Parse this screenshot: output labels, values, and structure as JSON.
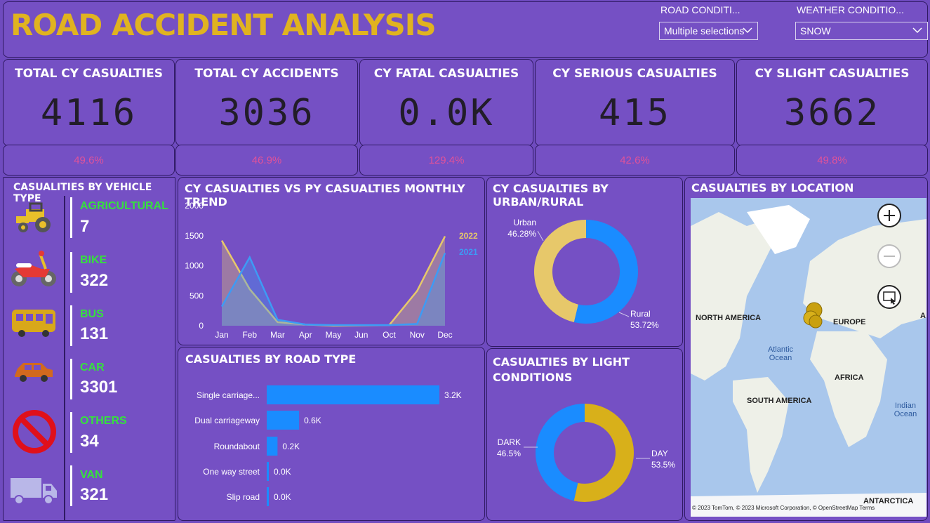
{
  "header": {
    "title": "ROAD ACCIDENT ANALYSIS",
    "slicers": [
      {
        "label": "ROAD CONDITI...",
        "value": "Multiple selections"
      },
      {
        "label": "WEATHER CONDITIO...",
        "value": "SNOW"
      }
    ]
  },
  "kpis": [
    {
      "title": "TOTAL CY CASUALTIES",
      "value": "4116",
      "pct": "49.6%"
    },
    {
      "title": "TOTAL CY ACCIDENTS",
      "value": "3036",
      "pct": "46.9%"
    },
    {
      "title": "CY FATAL CASUALTIES",
      "value": "0.0K",
      "pct": "129.4%"
    },
    {
      "title": "CY SERIOUS CASUALTIES",
      "value": "415",
      "pct": "42.6%"
    },
    {
      "title": "CY SLIGHT CASUALTIES",
      "value": "3662",
      "pct": "49.8%"
    }
  ],
  "vehicle": {
    "title": "CASUALITIES BY VEHICLE TYPE",
    "items": [
      {
        "name": "AGRICULTURAL",
        "value": "7",
        "icon": "tractor-icon"
      },
      {
        "name": "BIKE",
        "value": "322",
        "icon": "motorbike-icon"
      },
      {
        "name": "BUS",
        "value": "131",
        "icon": "bus-icon"
      },
      {
        "name": "CAR",
        "value": "3301",
        "icon": "car-icon"
      },
      {
        "name": "OTHERS",
        "value": "34",
        "icon": "prohibited-icon"
      },
      {
        "name": "VAN",
        "value": "321",
        "icon": "van-icon"
      }
    ]
  },
  "trend": {
    "title": "CY CASUALTIES VS PY CASUALTIES MONTHLY TREND"
  },
  "urban": {
    "title": "CY CASUALTIES BY URBAN/RURAL"
  },
  "road": {
    "title": "CASUALTIES BY ROAD TYPE"
  },
  "light": {
    "title": "CASUALTIES BY LIGHT CONDITIONS"
  },
  "location": {
    "title": "CASUALTIES BY LOCATION",
    "labels": {
      "north_america": "NORTH AMERICA",
      "europe": "EUROPE",
      "africa": "AFRICA",
      "south_america": "SOUTH AMERICA",
      "antarctica": "ANTARCTICA",
      "atlantic": "Atlantic Ocean",
      "indian": "Indian Ocean",
      "asia_edge": "A"
    },
    "copyright": "© 2023 TomTom, © 2023 Microsoft Corporation, © OpenStreetMap  Terms"
  },
  "chart_data": [
    {
      "type": "area",
      "title": "CY CASUALTIES VS PY CASUALTIES MONTHLY TREND",
      "categories": [
        "Jan",
        "Feb",
        "Mar",
        "Apr",
        "May",
        "Jun",
        "Oct",
        "Nov",
        "Dec"
      ],
      "ylim": [
        0,
        2000
      ],
      "yticks": [
        0,
        500,
        1000,
        1500,
        2000
      ],
      "series": [
        {
          "name": "2022",
          "values": [
            1420,
            610,
            60,
            20,
            0,
            null,
            10,
            580,
            1490
          ],
          "color": "#e7c86a"
        },
        {
          "name": "2021",
          "values": [
            320,
            1140,
            100,
            20,
            10,
            10,
            10,
            30,
            1210
          ],
          "color": "#3d9bf5"
        }
      ]
    },
    {
      "type": "pie",
      "title": "CY CASUALTIES BY URBAN/RURAL",
      "categories": [
        "Urban",
        "Rural"
      ],
      "values": [
        46.28,
        53.72
      ],
      "labels": [
        "46.28%",
        "53.72%"
      ],
      "colors": [
        "#e7c86a",
        "#1a8cff"
      ]
    },
    {
      "type": "bar",
      "title": "CASUALTIES BY ROAD TYPE",
      "categories": [
        "Single carriage...",
        "Dual carriageway",
        "Roundabout",
        "One way street",
        "Slip road"
      ],
      "values": [
        3.2,
        0.6,
        0.2,
        0.0,
        0.0
      ],
      "labels": [
        "3.2K",
        "0.6K",
        "0.2K",
        "0.0K",
        "0.0K"
      ],
      "color": "#1a8cff"
    },
    {
      "type": "pie",
      "title": "CASUALTIES BY LIGHT CONDITIONS",
      "categories": [
        "DARK",
        "DAY"
      ],
      "values": [
        46.5,
        53.5
      ],
      "labels": [
        "46.5%",
        "53.5%"
      ],
      "colors": [
        "#1a8cff",
        "#d8b01a"
      ]
    }
  ]
}
